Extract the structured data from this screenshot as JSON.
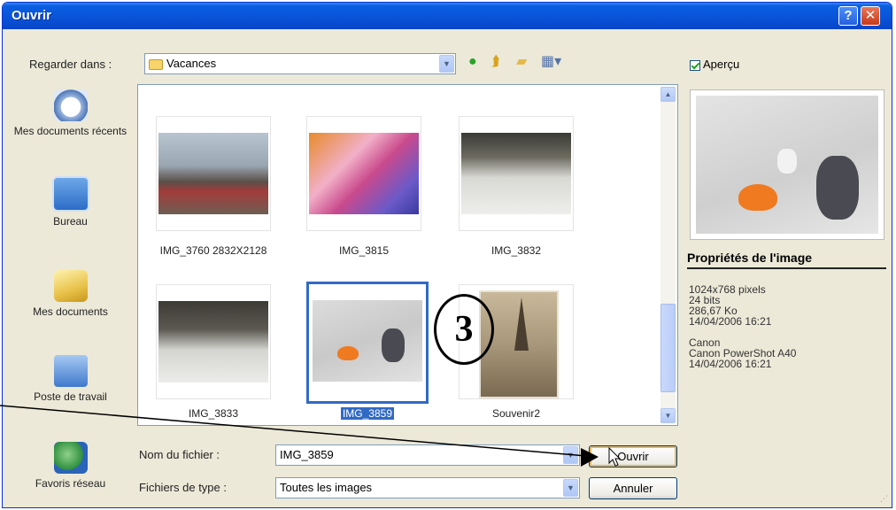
{
  "window": {
    "title": "Ouvrir",
    "help_symbol": "?",
    "close_symbol": "✕"
  },
  "look_in": {
    "label": "Regarder dans :",
    "value": "Vacances"
  },
  "places": [
    {
      "label": "Mes documents récents",
      "icon": "recent-documents-icon"
    },
    {
      "label": "Bureau",
      "icon": "desktop-icon"
    },
    {
      "label": "Mes documents",
      "icon": "my-documents-icon"
    },
    {
      "label": "Poste de travail",
      "icon": "my-computer-icon"
    },
    {
      "label": "Favoris réseau",
      "icon": "network-places-icon"
    }
  ],
  "files": [
    {
      "name": "IMG_3760 2832X2128",
      "selected": false
    },
    {
      "name": "IMG_3815",
      "selected": false
    },
    {
      "name": "IMG_3832",
      "selected": false
    },
    {
      "name": "IMG_3833",
      "selected": false
    },
    {
      "name": "IMG_3859",
      "selected": true
    },
    {
      "name": "Souvenir2",
      "selected": false
    }
  ],
  "filename": {
    "label": "Nom du fichier :",
    "value": "IMG_3859"
  },
  "filetype": {
    "label": "Fichiers de type :",
    "value": "Toutes les images"
  },
  "buttons": {
    "open": "Ouvrir",
    "cancel": "Annuler"
  },
  "preview": {
    "checkbox_label": "Aperçu",
    "checked": true
  },
  "properties": {
    "title": "Propriétés de l'image",
    "lines": [
      "1024x768 pixels",
      "24 bits",
      "286,67 Ko",
      "14/04/2006 16:21",
      "",
      "Canon",
      "Canon PowerShot A40",
      "14/04/2006 16:21"
    ]
  },
  "annotation": {
    "step": "3"
  },
  "colors": {
    "titlebar": "#0a53d8",
    "dialog_bg": "#ece9d8",
    "selection": "#316ac5"
  }
}
